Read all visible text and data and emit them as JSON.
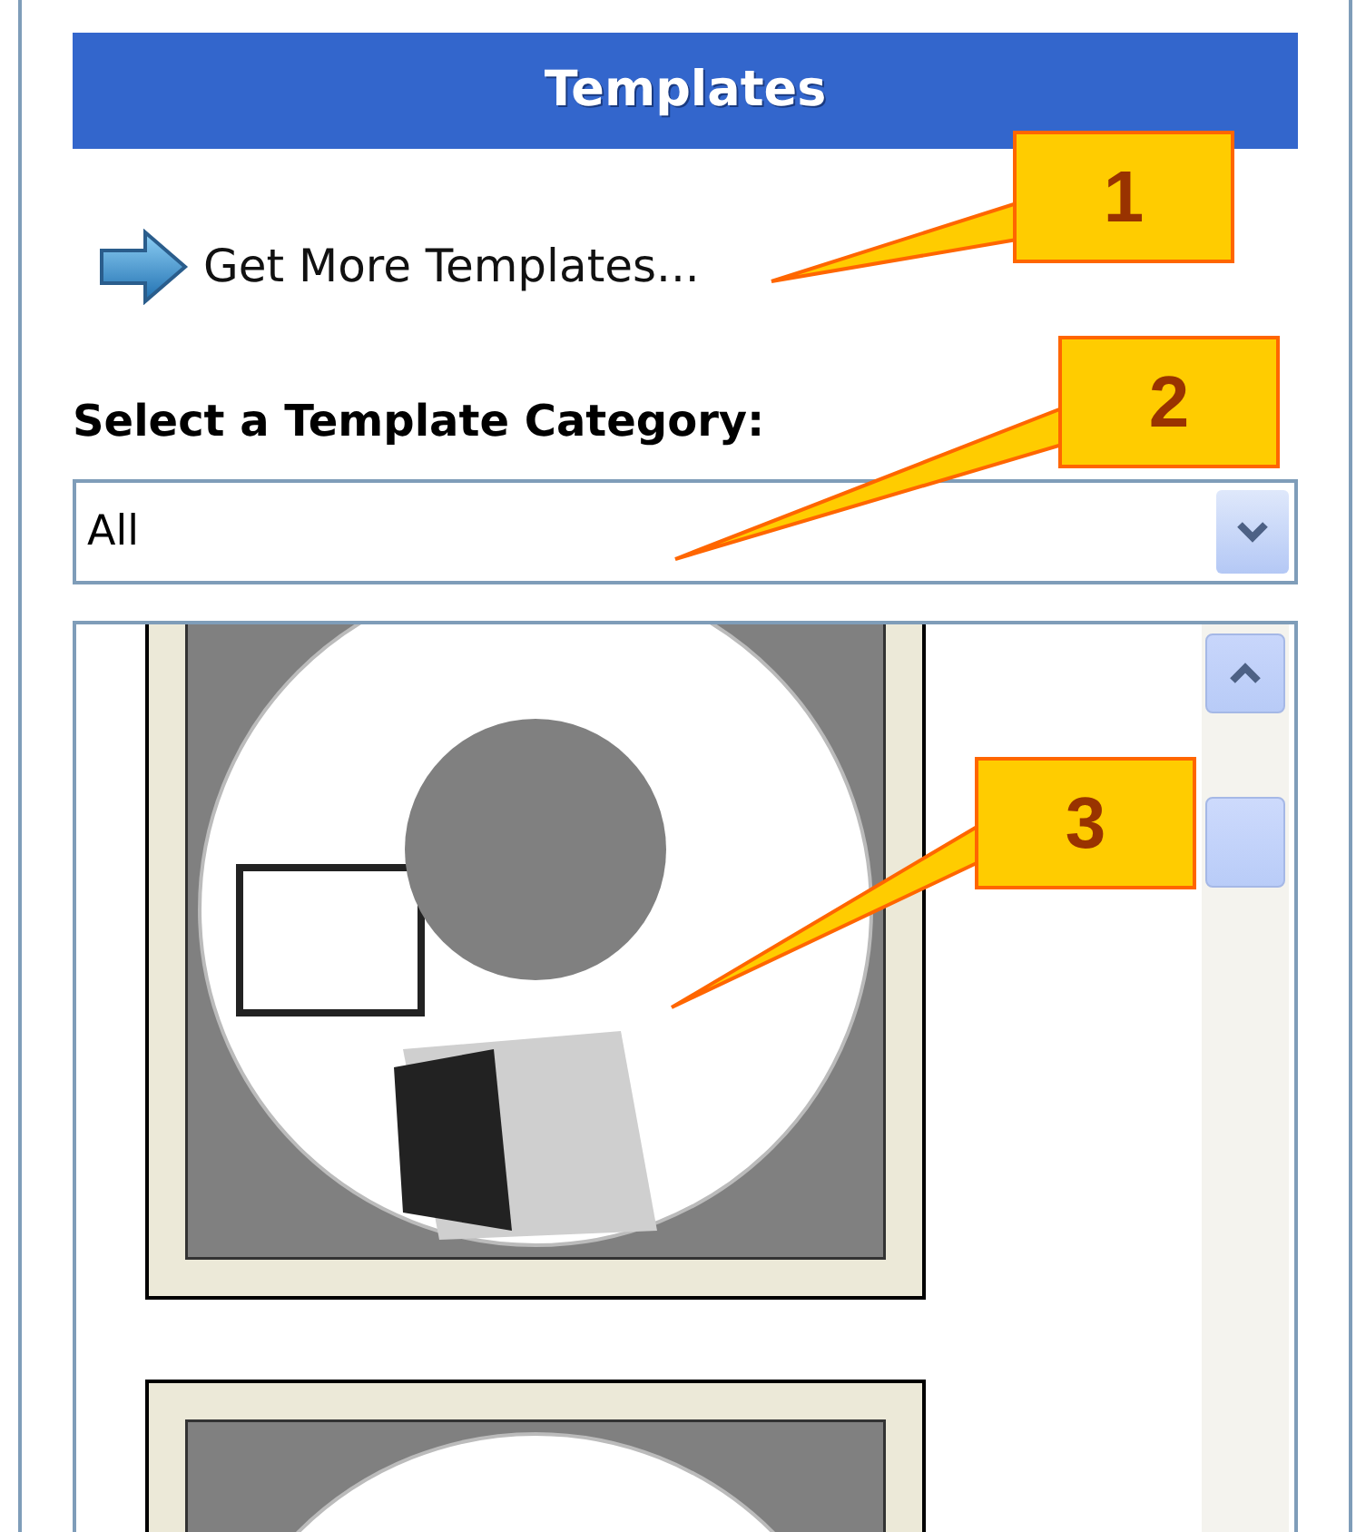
{
  "panel": {
    "title": "Templates"
  },
  "link": {
    "label": "Get More Templates..."
  },
  "category": {
    "label": "Select a Template Category:",
    "value": "All"
  },
  "callouts": [
    {
      "label": "1"
    },
    {
      "label": "2"
    },
    {
      "label": "3"
    }
  ]
}
